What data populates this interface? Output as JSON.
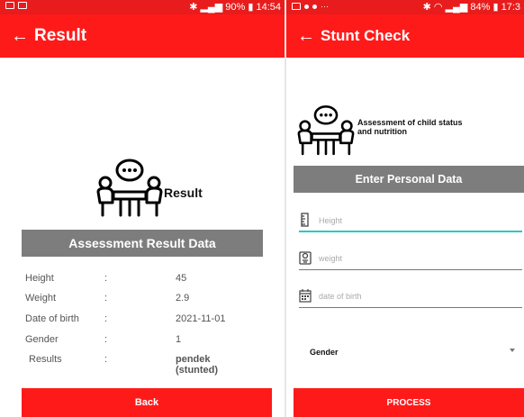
{
  "left_screen": {
    "status_time": "14:54",
    "status_battery": "90%",
    "title": "Result",
    "logo_label": "Result",
    "section_title": "Assessment Result Data",
    "rows": [
      {
        "label": "Height",
        "colon": ":",
        "value": "45"
      },
      {
        "label": "Weight",
        "colon": ":",
        "value": "2.9"
      },
      {
        "label": "Date of birth",
        "colon": ":",
        "value": "2021-11-01"
      },
      {
        "label": "Gender",
        "colon": ":",
        "value": "1"
      },
      {
        "label": "Results",
        "colon": ":",
        "value": "pendek (stunted)"
      }
    ],
    "back_button": "Back"
  },
  "right_screen": {
    "status_time": "17:3",
    "status_battery": "84%",
    "title": "Stunt Check",
    "description_line1": "Assessment of child status",
    "description_line2": "and nutrition",
    "section_title": "Enter Personal Data",
    "fields": {
      "height_placeholder": "Height",
      "weight_placeholder": "weight",
      "dob_placeholder": "date of birth"
    },
    "gender_label": "Gender",
    "process_button": "PROCESS"
  },
  "colors": {
    "appbar": "#ff1a1a",
    "section_bar": "#7d7d7d",
    "active_underline": "#2cc7c7"
  },
  "icons": [
    "back-arrow-icon",
    "logo-icon",
    "ruler-icon",
    "weight-scale-icon",
    "calendar-icon",
    "dropdown-arrow-icon"
  ]
}
